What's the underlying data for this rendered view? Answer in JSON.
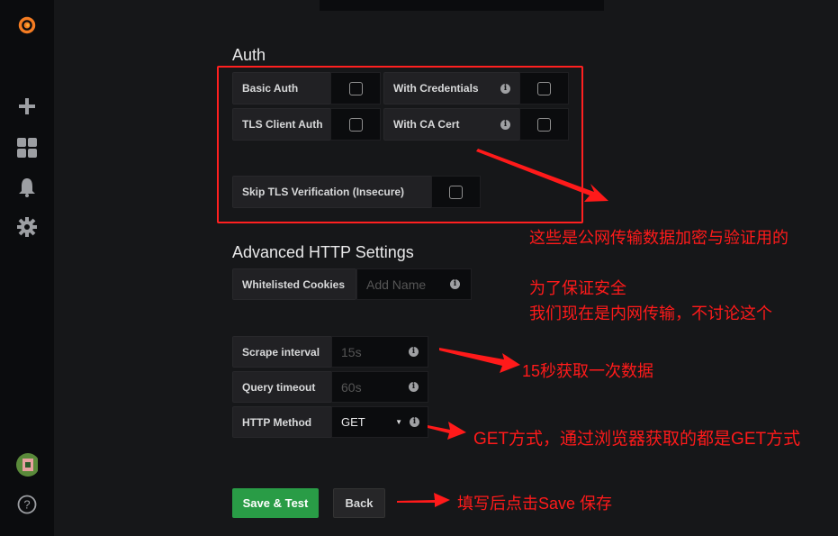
{
  "sidebar": {
    "items": [
      "grafana-logo",
      "create",
      "dashboards",
      "alerting",
      "configuration"
    ],
    "bottom": [
      "profile",
      "help"
    ]
  },
  "auth": {
    "title": "Auth",
    "basic_auth": "Basic Auth",
    "with_credentials": "With Credentials",
    "tls_client_auth": "TLS Client Auth",
    "with_ca_cert": "With CA Cert",
    "skip_tls": "Skip TLS Verification (Insecure)"
  },
  "advanced": {
    "title": "Advanced HTTP Settings",
    "whitelisted_cookies": "Whitelisted Cookies",
    "cookies_placeholder": "Add Name",
    "scrape_interval": "Scrape interval",
    "scrape_placeholder": "15s",
    "query_timeout": "Query timeout",
    "timeout_placeholder": "60s",
    "http_method": "HTTP Method",
    "http_method_value": "GET"
  },
  "buttons": {
    "save": "Save & Test",
    "back": "Back"
  },
  "annotations": {
    "a1": "这些是公网传输数据加密与验证用的",
    "a2": "为了保证安全",
    "a3": "我们现在是内网传输，不讨论这个",
    "a4": "15秒获取一次数据",
    "a5": "GET方式，通过浏览器获取的都是GET方式",
    "a6": "填写后点击Save 保存"
  },
  "colors": {
    "accent_red": "#ff1a1a",
    "save_green": "#299c46",
    "logo_orange": "#f05a28"
  }
}
